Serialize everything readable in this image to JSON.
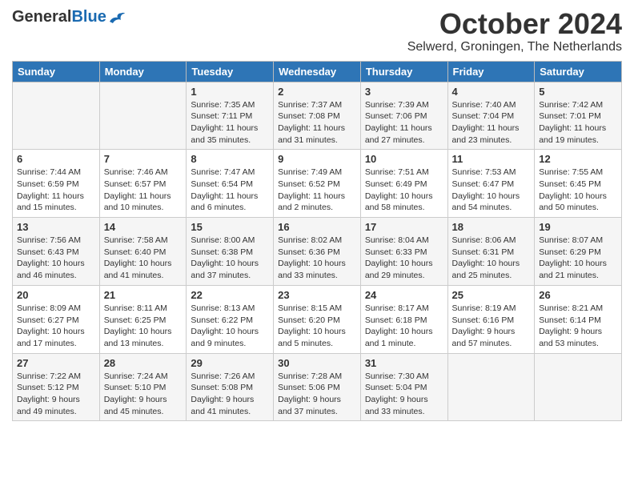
{
  "header": {
    "logo_general": "General",
    "logo_blue": "Blue",
    "month": "October 2024",
    "location": "Selwerd, Groningen, The Netherlands"
  },
  "days_of_week": [
    "Sunday",
    "Monday",
    "Tuesday",
    "Wednesday",
    "Thursday",
    "Friday",
    "Saturday"
  ],
  "weeks": [
    [
      {
        "day": "",
        "info": ""
      },
      {
        "day": "",
        "info": ""
      },
      {
        "day": "1",
        "info": "Sunrise: 7:35 AM\nSunset: 7:11 PM\nDaylight: 11 hours and 35 minutes."
      },
      {
        "day": "2",
        "info": "Sunrise: 7:37 AM\nSunset: 7:08 PM\nDaylight: 11 hours and 31 minutes."
      },
      {
        "day": "3",
        "info": "Sunrise: 7:39 AM\nSunset: 7:06 PM\nDaylight: 11 hours and 27 minutes."
      },
      {
        "day": "4",
        "info": "Sunrise: 7:40 AM\nSunset: 7:04 PM\nDaylight: 11 hours and 23 minutes."
      },
      {
        "day": "5",
        "info": "Sunrise: 7:42 AM\nSunset: 7:01 PM\nDaylight: 11 hours and 19 minutes."
      }
    ],
    [
      {
        "day": "6",
        "info": "Sunrise: 7:44 AM\nSunset: 6:59 PM\nDaylight: 11 hours and 15 minutes."
      },
      {
        "day": "7",
        "info": "Sunrise: 7:46 AM\nSunset: 6:57 PM\nDaylight: 11 hours and 10 minutes."
      },
      {
        "day": "8",
        "info": "Sunrise: 7:47 AM\nSunset: 6:54 PM\nDaylight: 11 hours and 6 minutes."
      },
      {
        "day": "9",
        "info": "Sunrise: 7:49 AM\nSunset: 6:52 PM\nDaylight: 11 hours and 2 minutes."
      },
      {
        "day": "10",
        "info": "Sunrise: 7:51 AM\nSunset: 6:49 PM\nDaylight: 10 hours and 58 minutes."
      },
      {
        "day": "11",
        "info": "Sunrise: 7:53 AM\nSunset: 6:47 PM\nDaylight: 10 hours and 54 minutes."
      },
      {
        "day": "12",
        "info": "Sunrise: 7:55 AM\nSunset: 6:45 PM\nDaylight: 10 hours and 50 minutes."
      }
    ],
    [
      {
        "day": "13",
        "info": "Sunrise: 7:56 AM\nSunset: 6:43 PM\nDaylight: 10 hours and 46 minutes."
      },
      {
        "day": "14",
        "info": "Sunrise: 7:58 AM\nSunset: 6:40 PM\nDaylight: 10 hours and 41 minutes."
      },
      {
        "day": "15",
        "info": "Sunrise: 8:00 AM\nSunset: 6:38 PM\nDaylight: 10 hours and 37 minutes."
      },
      {
        "day": "16",
        "info": "Sunrise: 8:02 AM\nSunset: 6:36 PM\nDaylight: 10 hours and 33 minutes."
      },
      {
        "day": "17",
        "info": "Sunrise: 8:04 AM\nSunset: 6:33 PM\nDaylight: 10 hours and 29 minutes."
      },
      {
        "day": "18",
        "info": "Sunrise: 8:06 AM\nSunset: 6:31 PM\nDaylight: 10 hours and 25 minutes."
      },
      {
        "day": "19",
        "info": "Sunrise: 8:07 AM\nSunset: 6:29 PM\nDaylight: 10 hours and 21 minutes."
      }
    ],
    [
      {
        "day": "20",
        "info": "Sunrise: 8:09 AM\nSunset: 6:27 PM\nDaylight: 10 hours and 17 minutes."
      },
      {
        "day": "21",
        "info": "Sunrise: 8:11 AM\nSunset: 6:25 PM\nDaylight: 10 hours and 13 minutes."
      },
      {
        "day": "22",
        "info": "Sunrise: 8:13 AM\nSunset: 6:22 PM\nDaylight: 10 hours and 9 minutes."
      },
      {
        "day": "23",
        "info": "Sunrise: 8:15 AM\nSunset: 6:20 PM\nDaylight: 10 hours and 5 minutes."
      },
      {
        "day": "24",
        "info": "Sunrise: 8:17 AM\nSunset: 6:18 PM\nDaylight: 10 hours and 1 minute."
      },
      {
        "day": "25",
        "info": "Sunrise: 8:19 AM\nSunset: 6:16 PM\nDaylight: 9 hours and 57 minutes."
      },
      {
        "day": "26",
        "info": "Sunrise: 8:21 AM\nSunset: 6:14 PM\nDaylight: 9 hours and 53 minutes."
      }
    ],
    [
      {
        "day": "27",
        "info": "Sunrise: 7:22 AM\nSunset: 5:12 PM\nDaylight: 9 hours and 49 minutes."
      },
      {
        "day": "28",
        "info": "Sunrise: 7:24 AM\nSunset: 5:10 PM\nDaylight: 9 hours and 45 minutes."
      },
      {
        "day": "29",
        "info": "Sunrise: 7:26 AM\nSunset: 5:08 PM\nDaylight: 9 hours and 41 minutes."
      },
      {
        "day": "30",
        "info": "Sunrise: 7:28 AM\nSunset: 5:06 PM\nDaylight: 9 hours and 37 minutes."
      },
      {
        "day": "31",
        "info": "Sunrise: 7:30 AM\nSunset: 5:04 PM\nDaylight: 9 hours and 33 minutes."
      },
      {
        "day": "",
        "info": ""
      },
      {
        "day": "",
        "info": ""
      }
    ]
  ]
}
